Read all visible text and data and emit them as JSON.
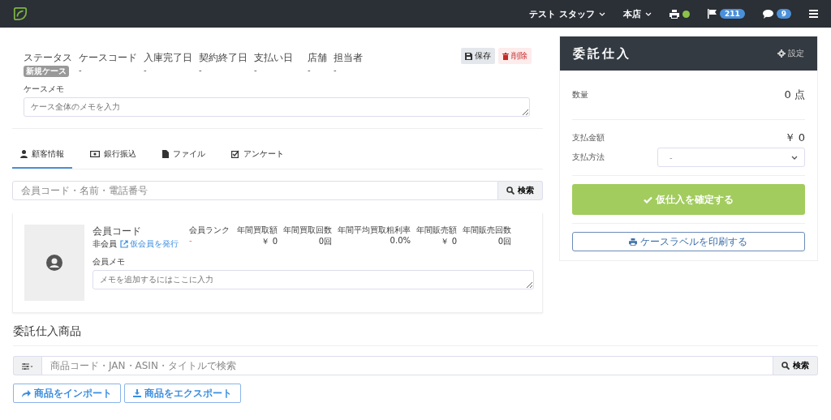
{
  "navbar": {
    "staff": "テスト スタッフ",
    "store": "本店",
    "printer_online": true,
    "flag_count": "211",
    "message_count": "9"
  },
  "case": {
    "fields": [
      {
        "label": "ステータス",
        "value": "新規ケース",
        "kind": "badge"
      },
      {
        "label": "ケースコード",
        "value": "-",
        "kind": "text"
      },
      {
        "label": "入庫完了日",
        "value": "-",
        "kind": "text"
      },
      {
        "label": "契約終了日",
        "value": "-",
        "kind": "text"
      },
      {
        "label": "支払い日",
        "value": "-",
        "kind": "text"
      },
      {
        "label": "店舗",
        "value": "-",
        "kind": "text"
      },
      {
        "label": "担当者",
        "value": "-",
        "kind": "text"
      }
    ],
    "save": "保存",
    "delete": "削除",
    "memo_label": "ケースメモ",
    "memo_placeholder": "ケース全体のメモを入力"
  },
  "tabs": [
    {
      "label": "顧客情報",
      "selected": true
    },
    {
      "label": "銀行振込",
      "selected": false
    },
    {
      "label": "ファイル",
      "selected": false
    },
    {
      "label": "アンケート",
      "selected": false
    }
  ],
  "customer_search": {
    "placeholder": "会員コード・名前・電話番号",
    "button": "検索"
  },
  "customer": {
    "code_label": "会員コード",
    "code_value": "非会員",
    "issue_link": "仮会員を発行",
    "stats": [
      {
        "label": "会員ランク",
        "value": "-",
        "kind": "rank"
      },
      {
        "label": "年間買取額",
        "value": "￥ 0",
        "kind": "num"
      },
      {
        "label": "年間買取回数",
        "value": "0回",
        "kind": "num"
      },
      {
        "label": "年間平均買取粗利率",
        "value": "0.0%",
        "kind": "num"
      },
      {
        "label": "年間販売額",
        "value": "￥ 0",
        "kind": "num"
      },
      {
        "label": "年間販売回数",
        "value": "0回",
        "kind": "num"
      }
    ],
    "memo_label": "会員メモ",
    "memo_placeholder": "メモを追加するにはここに入力"
  },
  "summary": {
    "title": "委託仕入",
    "settings": "設定",
    "quantity_label": "数量",
    "quantity": "0 点",
    "amount_label": "支払金額",
    "amount": "￥ 0",
    "method_label": "支払方法",
    "method_value": "-",
    "confirm": "仮仕入を確定する",
    "print": "ケースラベルを印刷する"
  },
  "products": {
    "title": "委託仕入商品",
    "placeholder": "商品コード・JAN・ASIN・タイトルで検索",
    "search": "検索",
    "import": "商品をインポート",
    "export": "商品をエクスポート"
  }
}
